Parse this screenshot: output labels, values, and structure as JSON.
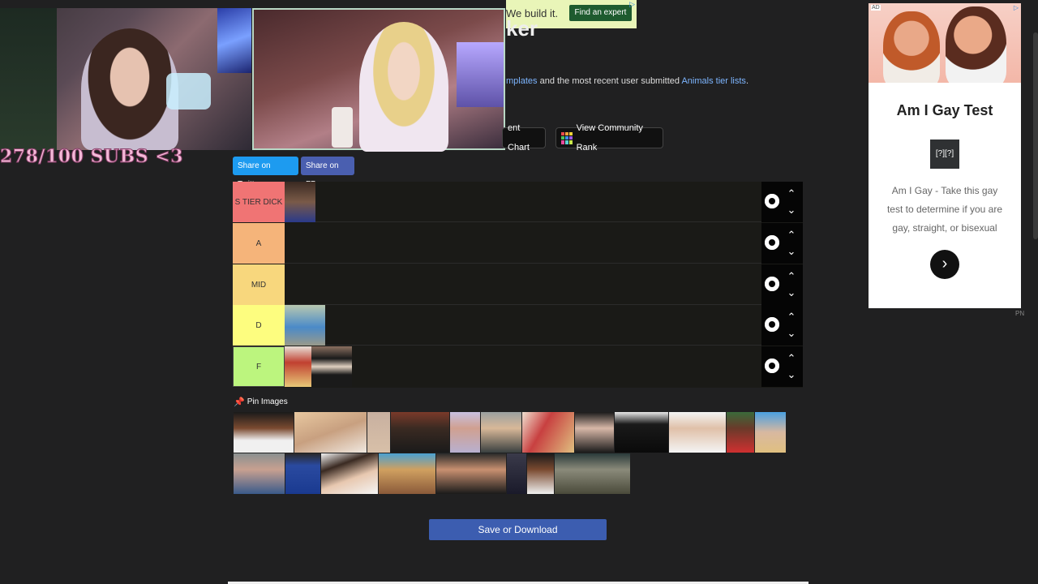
{
  "overlay": {
    "subs_counter": "278/100 SUBS <3"
  },
  "top_ad": {
    "text": "We build it.",
    "button": "Find an expert",
    "close_icon": "info-x-icon"
  },
  "heading_fragment": "ker",
  "description": {
    "part1": "mplates",
    "part2": " and the most recent user submitted ",
    "link": "Animals tier lists",
    "part3": "."
  },
  "toolbar": {
    "alignment_chart_label": "ent Chart",
    "community_rank_label": "View Community Rank"
  },
  "share": {
    "twitter_label": "Share on Twitter",
    "fb_label": "Share on FB",
    "twitter_color": "#1d9bf0",
    "fb_color": "#4a5fb0"
  },
  "tiers": [
    {
      "label": "S TIER DICK",
      "color": "#f07474",
      "items": [
        "#7a5a48"
      ]
    },
    {
      "label": "A",
      "color": "#f5b47a",
      "items": []
    },
    {
      "label": "MID",
      "color": "#f8d77d",
      "items": []
    },
    {
      "label": "D",
      "color": "#fdfd7f",
      "items": [
        "#6a8a6a"
      ]
    },
    {
      "label": "F",
      "color": "#bcf57e",
      "items": [
        "#c8a890",
        "#8a7060"
      ]
    }
  ],
  "pin_label": "Pin Images",
  "save_label": "Save or Download",
  "side_ad": {
    "ad_tag": "AD",
    "title": "Am I Gay Test",
    "logo_text": "[?][?]",
    "body": "Am I Gay - Take this gay test to determine if you are gay, straight, or bisexual",
    "arrow": "›",
    "footer": "PN"
  }
}
